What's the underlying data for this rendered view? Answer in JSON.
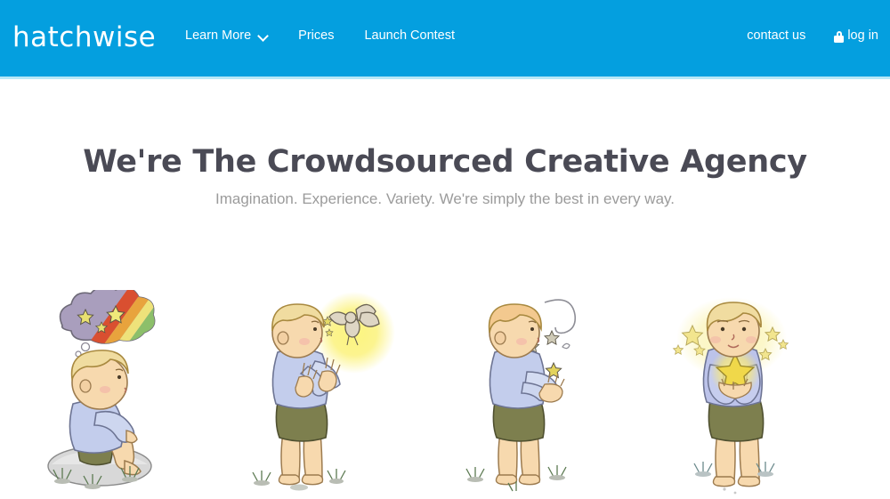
{
  "theme": {
    "header_bg": "#049fdf",
    "header_underline": "#b8e8f7",
    "page_bg": "#ffffff",
    "heading_color": "#4a4a55",
    "subheading_color": "#9b9b9b",
    "nav_text_color": "#ffffff"
  },
  "header": {
    "logo": "hatchwise",
    "nav_left": [
      {
        "label": "Learn More",
        "icon": "chevron-down-icon",
        "has_dropdown": true
      },
      {
        "label": "Prices",
        "has_dropdown": false
      },
      {
        "label": "Launch Contest",
        "has_dropdown": false
      }
    ],
    "nav_right": [
      {
        "label": "contact us",
        "icon": null
      },
      {
        "label": "log in",
        "icon": "lock-icon"
      }
    ]
  },
  "hero": {
    "title": "We're The Crowdsourced Creative Agency",
    "subtitle": "Imagination. Experience. Variety. We're simply the best in every way."
  },
  "illustrations": [
    {
      "name": "boy-sitting-on-rock-with-rainbow-thought-cloud",
      "alt": "Boy sitting on a rock daydreaming of a rainbow cloud with stars",
      "colors": {
        "hair": "#f0dca0",
        "skin": "#f7d9ae",
        "shirt": "#b9c4e8",
        "shorts": "#7d7f4e",
        "rock": "#d8d8d8",
        "cloud": "#a99ebd",
        "rainbow": [
          "#d94f30",
          "#e8a33d",
          "#eee27a",
          "#8cbf6a"
        ]
      }
    },
    {
      "name": "boy-reaching-for-glowing-fairy",
      "alt": "Boy standing with hands raised toward a glowing fairy",
      "colors": {
        "hair": "#f0dca0",
        "skin": "#f7d9ae",
        "shirt": "#b9c4e8",
        "shorts": "#7d7f4e",
        "glow": "#fbf06a",
        "fairy": "#b9ab93"
      }
    },
    {
      "name": "boy-cupping-hands-with-floating-stars",
      "alt": "Boy holding out cupped hands as stars float upward",
      "colors": {
        "hair": "#f3c98f",
        "skin": "#f7d9ae",
        "shirt": "#b9c4e8",
        "shorts": "#7d7f4e",
        "star": "#e3d35c"
      }
    },
    {
      "name": "boy-holding-glowing-star",
      "alt": "Boy holding a bright glowing star with stars around his head",
      "colors": {
        "hair": "#f0dca0",
        "skin": "#f7d9ae",
        "shirt": "#b9bce8",
        "shorts": "#7d7f4e",
        "glow": "#faf2a8",
        "star": "#f0d84a"
      }
    }
  ]
}
